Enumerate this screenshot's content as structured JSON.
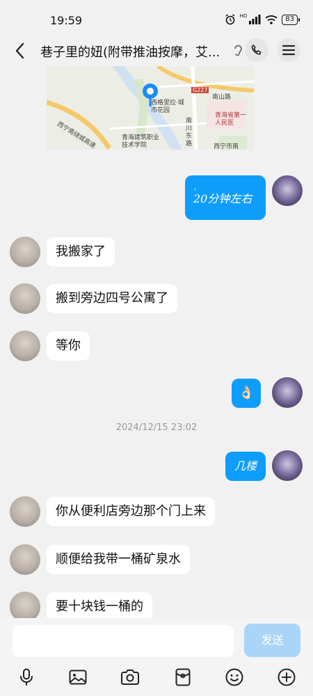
{
  "status": {
    "time": "19:59",
    "signal_label": "HD",
    "battery": "83"
  },
  "header": {
    "title": "巷子里的妞(附带推油按摩，艾..."
  },
  "map": {
    "labels": {
      "poi_name": "西格里拉·城市花园",
      "road_g227": "G227",
      "nanshan_road": "南山路",
      "hospital": "青海省第一人民医",
      "nanchuan": "南川东路",
      "expressway": "西宁南绕城高速",
      "college": "青海建筑职业技术学院",
      "xining": "西宁市南"
    }
  },
  "messages": [
    {
      "side": "out",
      "text": "20分钟左右",
      "pre": "，"
    },
    {
      "side": "in",
      "text": "我搬家了"
    },
    {
      "side": "in",
      "text": "搬到旁边四号公寓了"
    },
    {
      "side": "in",
      "text": "等你"
    },
    {
      "side": "out",
      "text": "👌🏻"
    },
    {
      "side": "out",
      "text": "几楼"
    },
    {
      "side": "in",
      "text": "你从便利店旁边那个门上来"
    },
    {
      "side": "in",
      "text": "顺便给我带一桶矿泉水"
    },
    {
      "side": "in",
      "text": "要十块钱一桶的"
    }
  ],
  "timestamp": "2024/12/15 23:02",
  "composer": {
    "placeholder": "",
    "send_label": "发送"
  },
  "icons": {
    "back": "chevron-left-icon",
    "call": "phone-icon",
    "menu": "menu-icon",
    "mic": "microphone-icon",
    "image": "image-icon",
    "camera": "camera-icon",
    "red_packet": "red-packet-icon",
    "emoji": "emoji-icon",
    "plus": "plus-icon"
  },
  "colors": {
    "outgoing_bubble": "#0f9dfb",
    "incoming_bubble": "#ffffff",
    "send_button": "#a9d6f8"
  }
}
